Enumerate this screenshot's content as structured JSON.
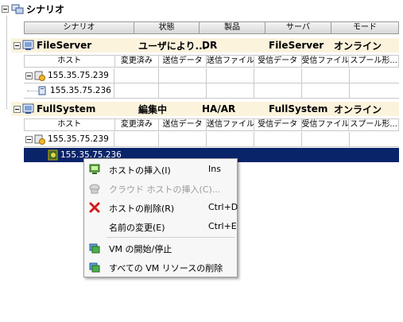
{
  "tree": {
    "root_label": "シナリオ",
    "columns": [
      "シナリオ",
      "状態",
      "製品",
      "サーバ",
      "モード"
    ],
    "host_columns": [
      "ホスト",
      "変更済み",
      "送信データ",
      "送信ファイル",
      "受信データ",
      "受信ファイル",
      "スプール形..."
    ],
    "scenarios": [
      {
        "name": "FileServer",
        "status": "ユーザにより...",
        "product": "DR",
        "server": "FileServer",
        "mode": "オンライン",
        "hosts": [
          {
            "label": "155.35.75.239"
          },
          {
            "label": "155.35.75.236"
          }
        ]
      },
      {
        "name": "FullSystem",
        "status": "編集中",
        "product": "HA/AR",
        "server": "FullSystem",
        "mode": "オンライン",
        "hosts": [
          {
            "label": "155.35.75.239"
          },
          {
            "label": "155.35.75.236"
          }
        ]
      }
    ]
  },
  "context_menu": {
    "items": [
      {
        "label": "ホストの挿入(I)",
        "shortcut": "Ins",
        "icon": "host-insert-icon",
        "enabled": true
      },
      {
        "label": "クラウド ホストの挿入(C)...",
        "shortcut": "",
        "icon": "cloud-host-icon",
        "enabled": false
      },
      {
        "label": "ホストの削除(R)",
        "shortcut": "Ctrl+D",
        "icon": "delete-x-icon",
        "enabled": true
      },
      {
        "label": "名前の変更(E)",
        "shortcut": "Ctrl+E",
        "icon": "",
        "enabled": true
      },
      {
        "label": "VM の開始/停止",
        "shortcut": "",
        "icon": "vm-start-stop-icon",
        "enabled": true
      },
      {
        "label": "すべての VM リソースの削除",
        "shortcut": "",
        "icon": "vm-delete-resources-icon",
        "enabled": true
      }
    ]
  },
  "colors": {
    "selection": "#0a246a",
    "section_header_bg": "#fbf3dc"
  }
}
